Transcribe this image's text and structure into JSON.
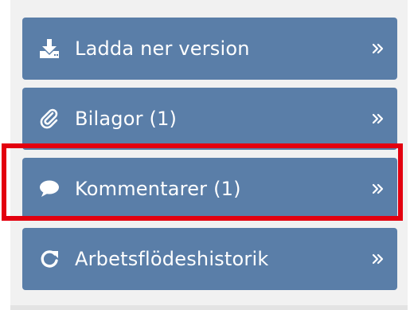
{
  "menu": {
    "items": [
      {
        "label": "Ladda ner version",
        "icon": "download-icon"
      },
      {
        "label": "Bilagor (1)",
        "icon": "paperclip-icon"
      },
      {
        "label": "Kommentarer (1)",
        "icon": "comment-icon"
      },
      {
        "label": "Arbetsflödeshistorik",
        "icon": "refresh-icon"
      }
    ],
    "chevron_icon": "double-chevron-right-icon"
  },
  "highlight": {
    "target": "menu.items.2",
    "color": "#e3000f"
  },
  "colors": {
    "button_background": "#5a7ea8",
    "button_text": "#ffffff",
    "panel_background": "#f1f1f1"
  }
}
